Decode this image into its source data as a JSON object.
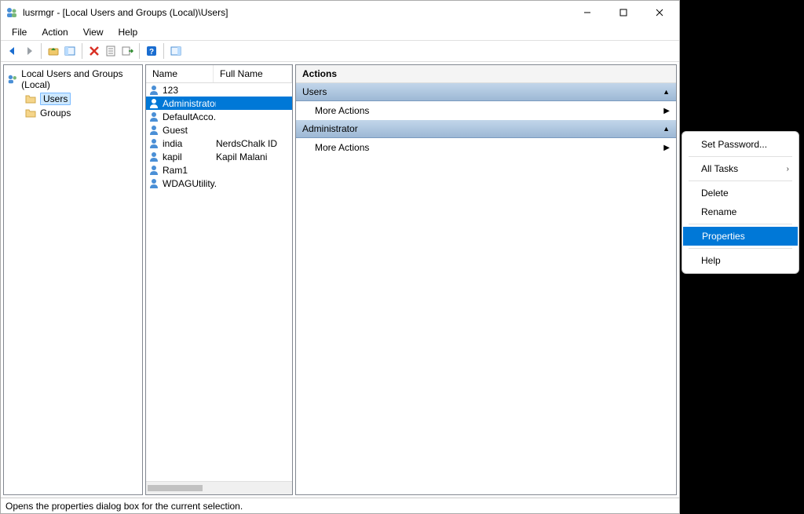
{
  "window": {
    "title": "lusrmgr - [Local Users and Groups (Local)\\Users]"
  },
  "menu": {
    "file": "File",
    "action": "Action",
    "view": "View",
    "help": "Help"
  },
  "nav": {
    "root": "Local Users and Groups (Local)",
    "users": "Users",
    "groups": "Groups"
  },
  "list": {
    "col_name": "Name",
    "col_full": "Full Name",
    "rows": [
      {
        "name": "123",
        "full": ""
      },
      {
        "name": "Administrator",
        "full": ""
      },
      {
        "name": "DefaultAcco...",
        "full": ""
      },
      {
        "name": "Guest",
        "full": ""
      },
      {
        "name": "india",
        "full": "NerdsChalk ID"
      },
      {
        "name": "kapil",
        "full": "Kapil Malani"
      },
      {
        "name": "Ram1",
        "full": ""
      },
      {
        "name": "WDAGUtility...",
        "full": ""
      }
    ],
    "selected_index": 1
  },
  "actions": {
    "header": "Actions",
    "section1": "Users",
    "more1": "More Actions",
    "section2": "Administrator",
    "more2": "More Actions"
  },
  "context_menu": {
    "set_password": "Set Password...",
    "all_tasks": "All Tasks",
    "delete": "Delete",
    "rename": "Rename",
    "properties": "Properties",
    "help": "Help"
  },
  "status": "Opens the properties dialog box for the current selection."
}
